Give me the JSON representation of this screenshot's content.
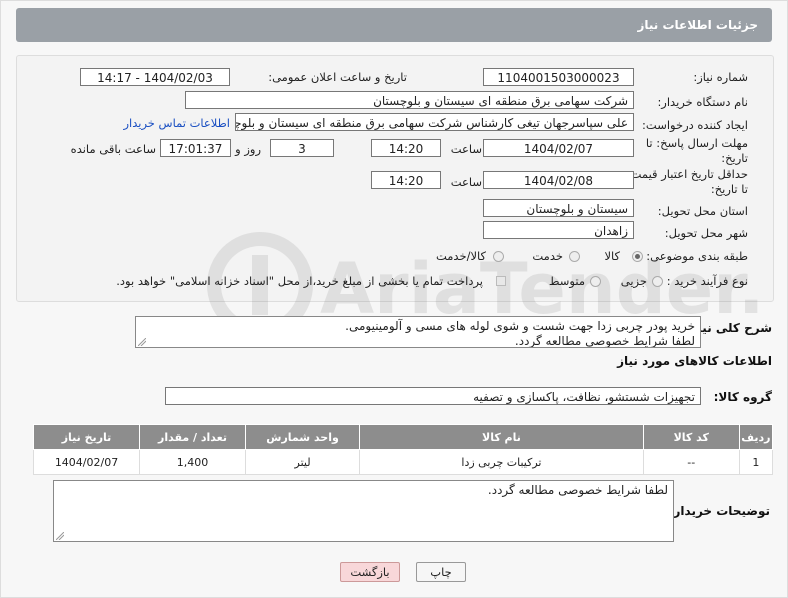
{
  "header": {
    "title": "جزئیات اطلاعات نیاز"
  },
  "form": {
    "need_number_label": "شماره نیاز:",
    "need_number": "1104001503000023",
    "announce_label": "تاریخ و ساعت اعلان عمومی:",
    "announce_value": "1404/02/03 - 14:17",
    "buyer_org_label": "نام دستگاه خریدار:",
    "buyer_org": "شرکت سهامی برق منطقه ای سیستان و بلوچستان",
    "creator_label": "ایجاد کننده درخواست:",
    "creator": "علی سپاسرجهان تیغی کارشناس شرکت سهامی برق منطقه ای سیستان و بلوچستان",
    "contact_link": "اطلاعات تماس خریدار",
    "deadline_label_1": "مهلت ارسال پاسخ: تا",
    "deadline_label_2": "تاریخ:",
    "deadline_date": "1404/02/07",
    "time_label": "ساعت",
    "deadline_time": "14:20",
    "days_value": "3",
    "days_label": "روز و",
    "remaining_time": "17:01:37",
    "remaining_label": "ساعت باقی مانده",
    "validity_label_1": "حداقل تاریخ اعتبار قیمت:",
    "validity_label_2": "تا تاریخ:",
    "validity_date": "1404/02/08",
    "validity_time": "14:20",
    "province_label": "استان محل تحویل:",
    "province": "سیستان و بلوچستان",
    "city_label": "شهر محل تحویل:",
    "city": "زاهدان",
    "category_label": "طبقه بندی موضوعی:",
    "category_options": [
      "کالا",
      "خدمت",
      "کالا/خدمت"
    ],
    "process_label": "نوع فرآیند خرید :",
    "process_options": [
      "جزیی",
      "متوسط"
    ],
    "payment_note": "پرداخت تمام یا بخشی از مبلغ خرید،از محل \"اسناد خزانه اسلامی\" خواهد بود."
  },
  "description": {
    "label": "شرح کلی نیاز:",
    "line1": "خرید پودر چربی زدا جهت شست و شوی لوله های مسی و آلومینیومی.",
    "line2": "لطفا شرایط خصوصی مطالعه گردد."
  },
  "goods": {
    "section_title": "اطلاعات کالاهای مورد نیاز",
    "group_label": "گروه کالا:",
    "group_value": "تجهیزات شستشو، نظافت، پاکسازی و تصفیه",
    "columns": [
      "ردیف",
      "کد کالا",
      "نام کالا",
      "واحد شمارش",
      "تعداد / مقدار",
      "تاریخ نیاز"
    ],
    "rows": [
      [
        "1",
        "--",
        "ترکیبات چربی زدا",
        "لیتر",
        "1,400",
        "1404/02/07"
      ]
    ]
  },
  "buyer_notes": {
    "label": "توضیحات خریدار:",
    "text": "لطفا شرایط خصوصی مطالعه گردد."
  },
  "buttons": {
    "print": "چاپ",
    "back": "بازگشت"
  },
  "watermark": {
    "text": "AriaTender.neT"
  },
  "colors": {
    "header_bg": "#9aa0a6",
    "link": "#1a4fc2",
    "table_header": "#8d8d8d",
    "back_button": "#f8d7d9"
  }
}
